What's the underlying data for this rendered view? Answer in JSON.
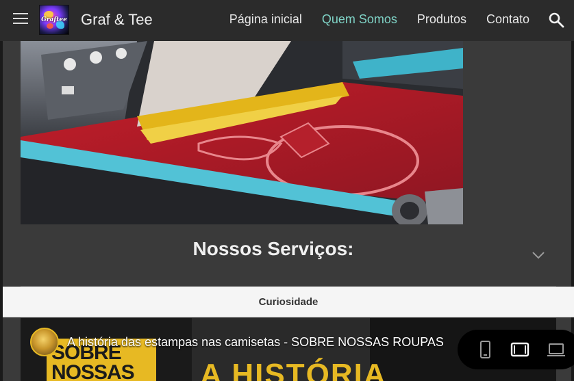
{
  "header": {
    "logo_text": "Graftee",
    "site_title": "Graf & Tee",
    "nav": [
      {
        "label": "Página inicial",
        "active": false
      },
      {
        "label": "Quem Somos",
        "active": true
      },
      {
        "label": "Produtos",
        "active": false
      },
      {
        "label": "Contato",
        "active": false
      }
    ],
    "icons": {
      "menu": "hamburger-menu-icon",
      "search": "search-icon"
    }
  },
  "main": {
    "section_title": "Nossos Serviços:",
    "chevron_icon": "chevron-down-icon"
  },
  "curiosity": {
    "label": "Curiosidade"
  },
  "video": {
    "title": "A história das estampas nas camisetas - SOBRE NOSSAS ROUPAS",
    "thumb_text_line1": "SOBRE",
    "thumb_text_line2": "NOSSAS",
    "thumb_big_text": "A HISTÓRIA"
  },
  "device_switcher": {
    "options": [
      "phone-icon",
      "tablet-icon",
      "laptop-icon"
    ],
    "selected": "tablet-icon"
  },
  "colors": {
    "header_bg": "#2b2b2b",
    "page_bg": "#3a3a3a",
    "nav_active": "#7fd3c6",
    "accent_yellow": "#e7b923"
  }
}
